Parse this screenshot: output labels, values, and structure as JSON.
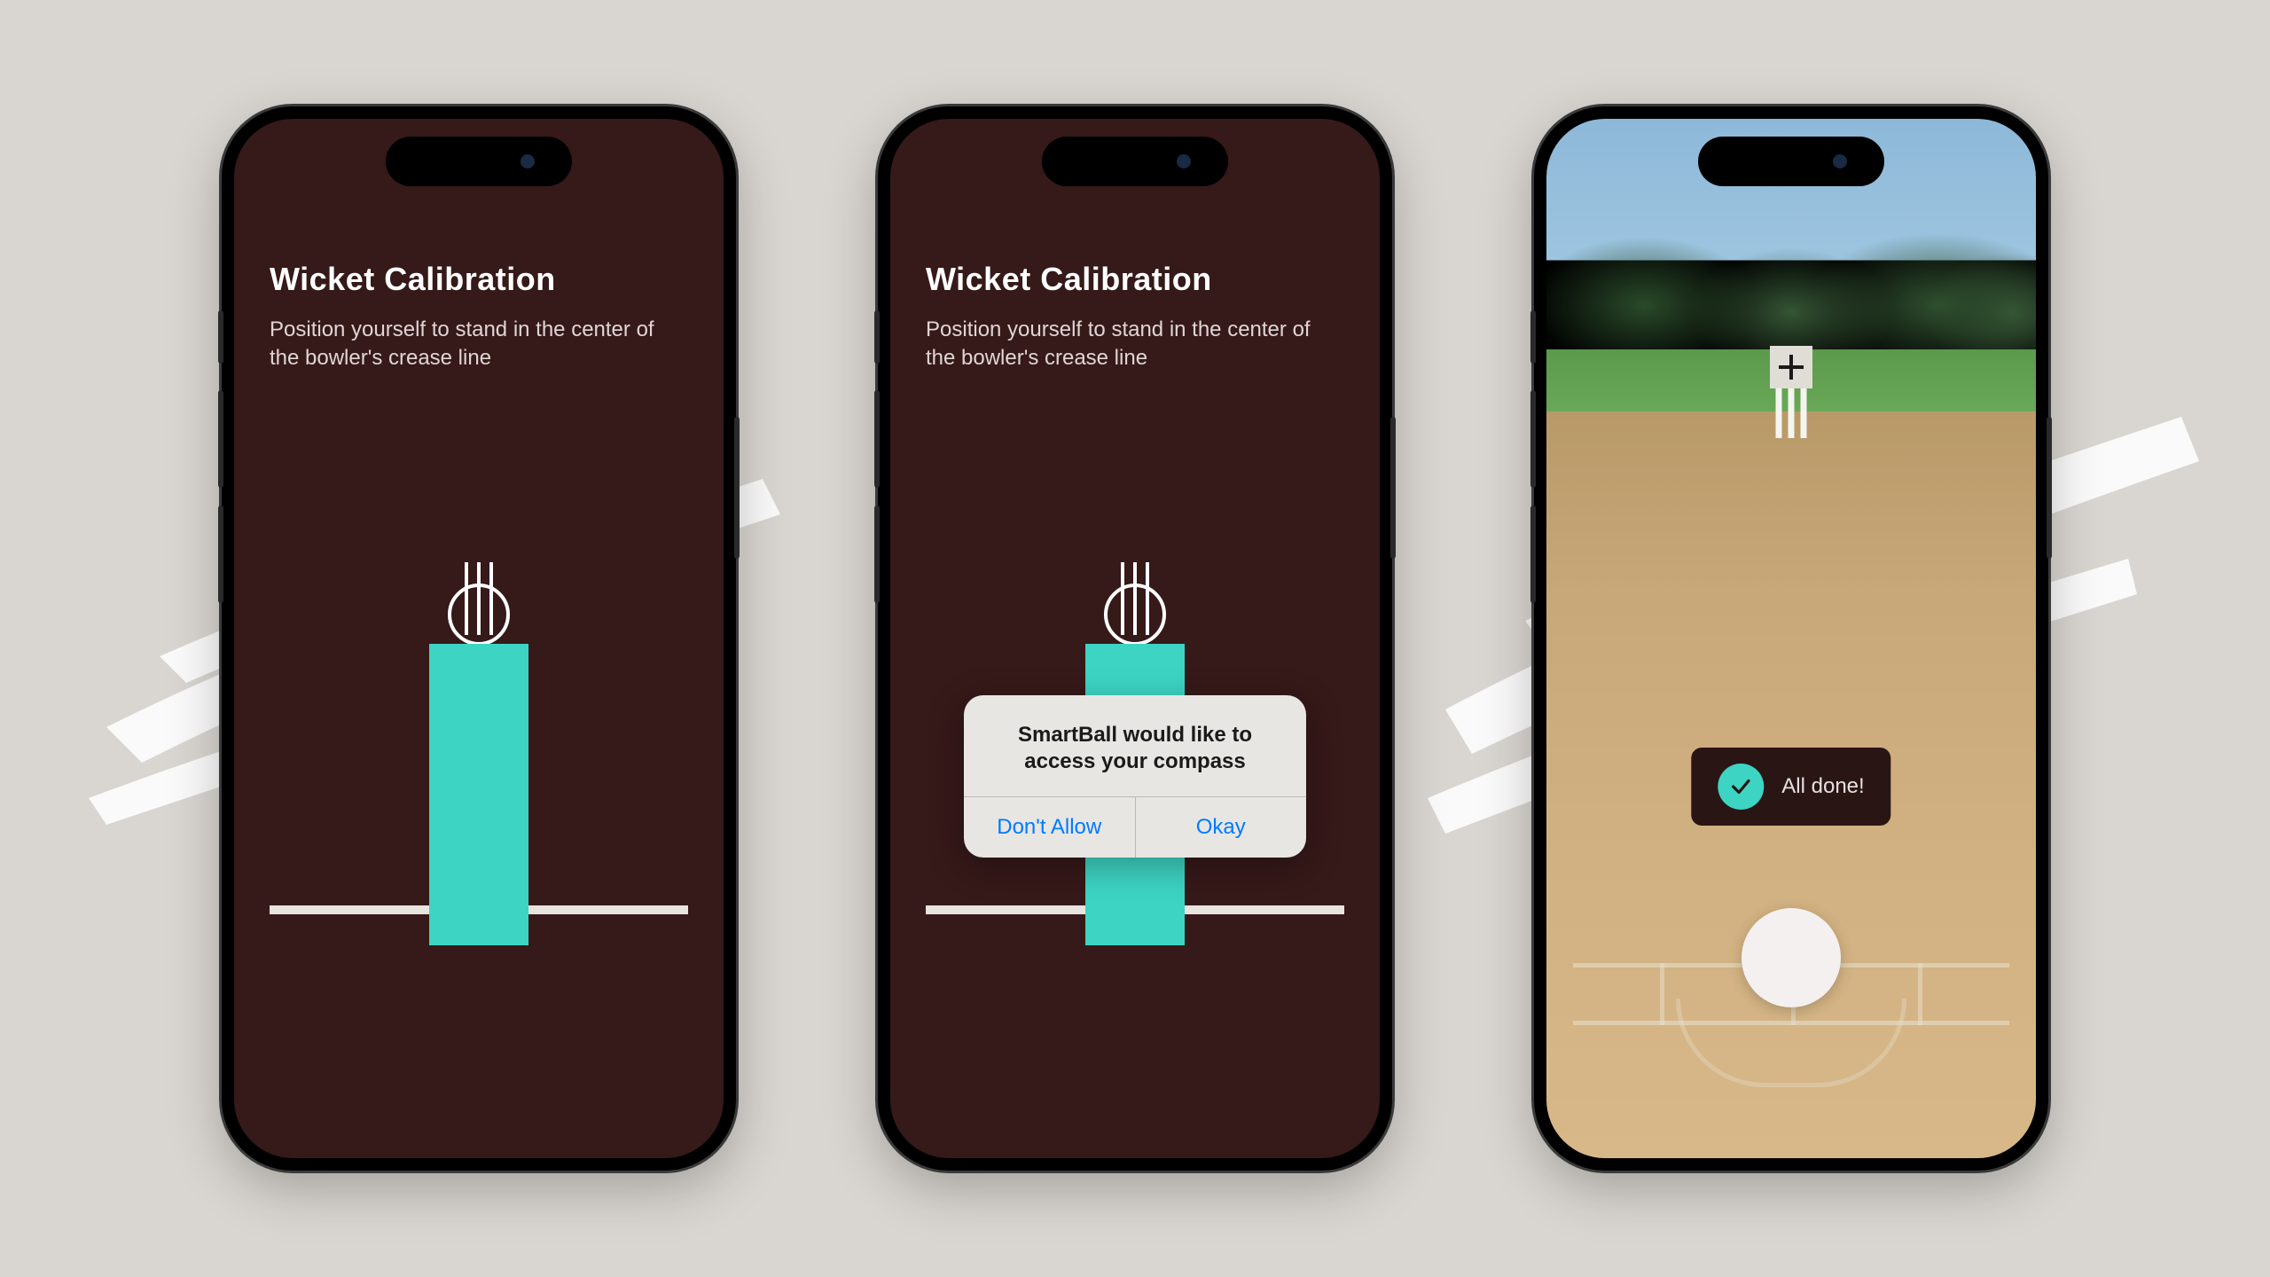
{
  "screen1": {
    "title": "Wicket Calibration",
    "subtitle": "Position yourself to stand in the center of the bowler's crease line"
  },
  "screen2": {
    "title": "Wicket Calibration",
    "subtitle": "Position yourself to stand in the center of the bowler's crease line",
    "alert": {
      "title": "SmartBall would like to access your compass",
      "deny": "Don't Allow",
      "allow": "Okay"
    }
  },
  "screen3": {
    "toast": "All done!"
  },
  "colors": {
    "screen_bg": "#361919",
    "accent": "#3dd4c3",
    "ios_link": "#007aff"
  }
}
